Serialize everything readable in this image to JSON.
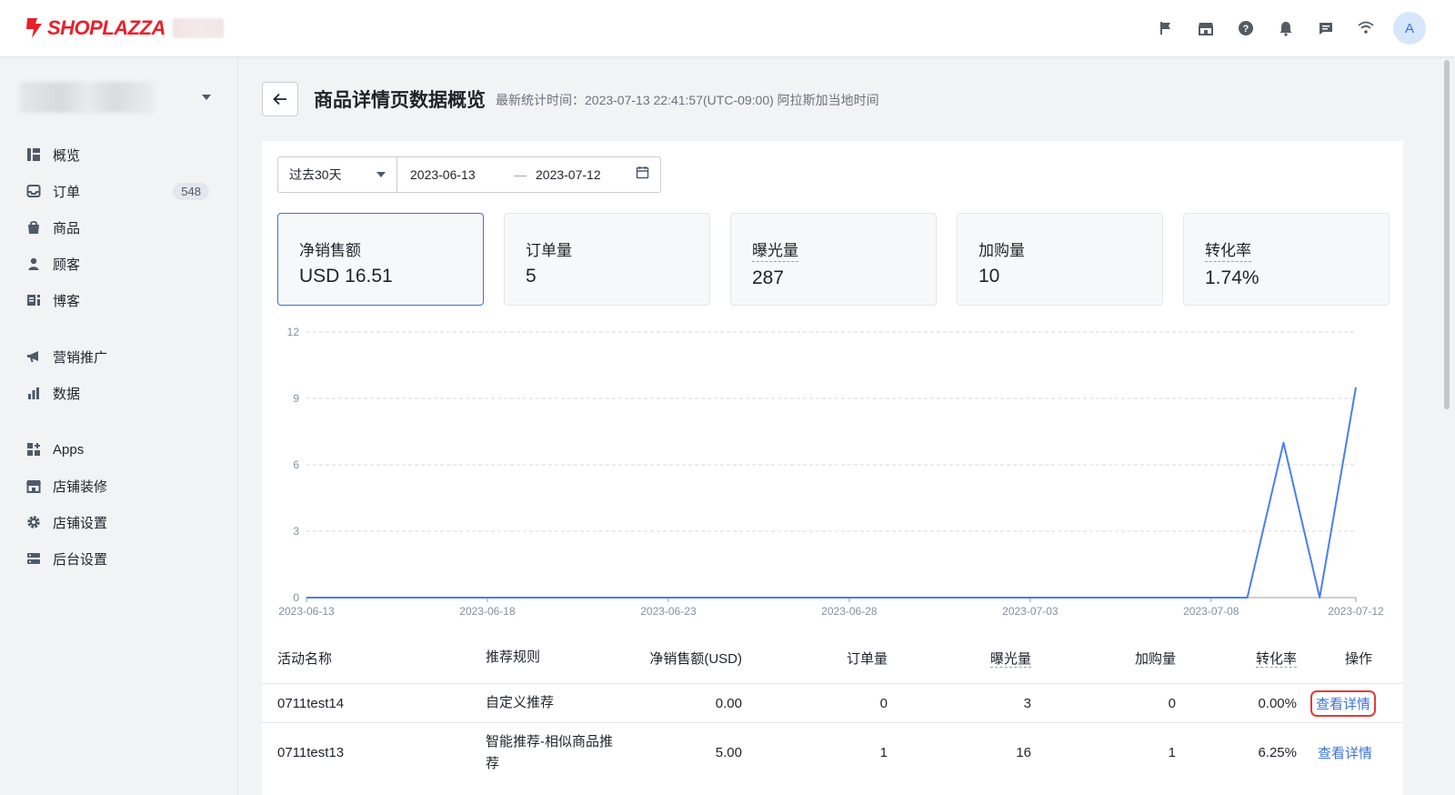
{
  "header": {
    "brand": "SHOPLAZZA",
    "icons": [
      "flag-icon",
      "store-icon",
      "help-icon",
      "bell-icon",
      "message-icon",
      "wifi-icon"
    ],
    "avatar_initial": "A"
  },
  "sidebar": {
    "items": [
      {
        "label": "概览",
        "icon": "overview-icon"
      },
      {
        "label": "订单",
        "icon": "inbox-icon",
        "badge": "548"
      },
      {
        "label": "商品",
        "icon": "bag-icon"
      },
      {
        "label": "顾客",
        "icon": "person-icon"
      },
      {
        "label": "博客",
        "icon": "blog-icon"
      },
      {
        "label": "营销推广",
        "icon": "megaphone-icon"
      },
      {
        "label": "数据",
        "icon": "bar-chart-icon"
      },
      {
        "label": "Apps",
        "icon": "apps-icon"
      },
      {
        "label": "店铺装修",
        "icon": "store-icon"
      },
      {
        "label": "店铺设置",
        "icon": "gear-icon"
      },
      {
        "label": "后台设置",
        "icon": "server-icon"
      }
    ]
  },
  "page": {
    "title": "商品详情页数据概览",
    "meta": "最新统计时间：2023-07-13 22:41:57(UTC-09:00) 阿拉斯加当地时间"
  },
  "filter": {
    "preset": "过去30天",
    "start": "2023-06-13",
    "sep": "—",
    "end": "2023-07-12"
  },
  "metrics": [
    {
      "label": "净销售额",
      "value": "USD 16.51"
    },
    {
      "label": "订单量",
      "value": "5"
    },
    {
      "label": "曝光量",
      "value": "287"
    },
    {
      "label": "加购量",
      "value": "10"
    },
    {
      "label": "转化率",
      "value": "1.74%"
    }
  ],
  "chart_data": {
    "type": "line",
    "x": [
      "2023-06-13",
      "2023-06-14",
      "2023-06-15",
      "2023-06-16",
      "2023-06-17",
      "2023-06-18",
      "2023-06-19",
      "2023-06-20",
      "2023-06-21",
      "2023-06-22",
      "2023-06-23",
      "2023-06-24",
      "2023-06-25",
      "2023-06-26",
      "2023-06-27",
      "2023-06-28",
      "2023-06-29",
      "2023-06-30",
      "2023-07-01",
      "2023-07-02",
      "2023-07-03",
      "2023-07-04",
      "2023-07-05",
      "2023-07-06",
      "2023-07-07",
      "2023-07-08",
      "2023-07-09",
      "2023-07-10",
      "2023-07-11",
      "2023-07-12"
    ],
    "series": [
      {
        "values": [
          0,
          0,
          0,
          0,
          0,
          0,
          0,
          0,
          0,
          0,
          0,
          0,
          0,
          0,
          0,
          0,
          0,
          0,
          0,
          0,
          0,
          0,
          0,
          0,
          0,
          0,
          0,
          7,
          0,
          9.5
        ]
      }
    ],
    "x_tick_labels": [
      "2023-06-13",
      "2023-06-18",
      "2023-06-23",
      "2023-06-28",
      "2023-07-03",
      "2023-07-08",
      "2023-07-12"
    ],
    "y_ticks": [
      "0",
      "3",
      "6",
      "9",
      "12"
    ],
    "ylim": [
      0,
      12
    ],
    "grid": true,
    "color": "#4a7ef0"
  },
  "table": {
    "headers": [
      "活动名称",
      "推荐规则",
      "净销售额(USD)",
      "订单量",
      "曝光量",
      "加购量",
      "转化率",
      "操作"
    ],
    "rows": [
      {
        "name": "0711test14",
        "rule": "自定义推荐",
        "sales": "0.00",
        "orders": "0",
        "views": "3",
        "carts": "0",
        "rate": "0.00%",
        "action": "查看详情"
      },
      {
        "name": "0711test13",
        "rule": "智能推荐-相似商品推荐",
        "sales": "5.00",
        "orders": "1",
        "views": "16",
        "carts": "1",
        "rate": "6.25%",
        "action": "查看详情"
      }
    ]
  }
}
